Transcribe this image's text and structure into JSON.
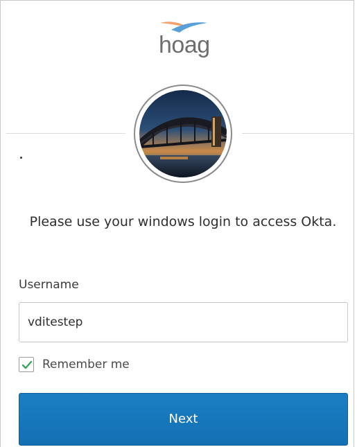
{
  "logo": {
    "text": "hoag",
    "swoosh_colors": [
      "#f3a36a",
      "#5aa0d8"
    ]
  },
  "avatar": {
    "icon": "sydney-harbour-bridge-photo"
  },
  "message": "Please use your windows login to access Okta.",
  "form": {
    "username_label": "Username",
    "username_value": "vditestep",
    "remember_checked": true,
    "remember_label": "Remember me",
    "next_label": "Next"
  },
  "colors": {
    "primary_button": "#1677bb",
    "checkmark": "#3aa35a",
    "logo_text": "#6e6e70"
  }
}
